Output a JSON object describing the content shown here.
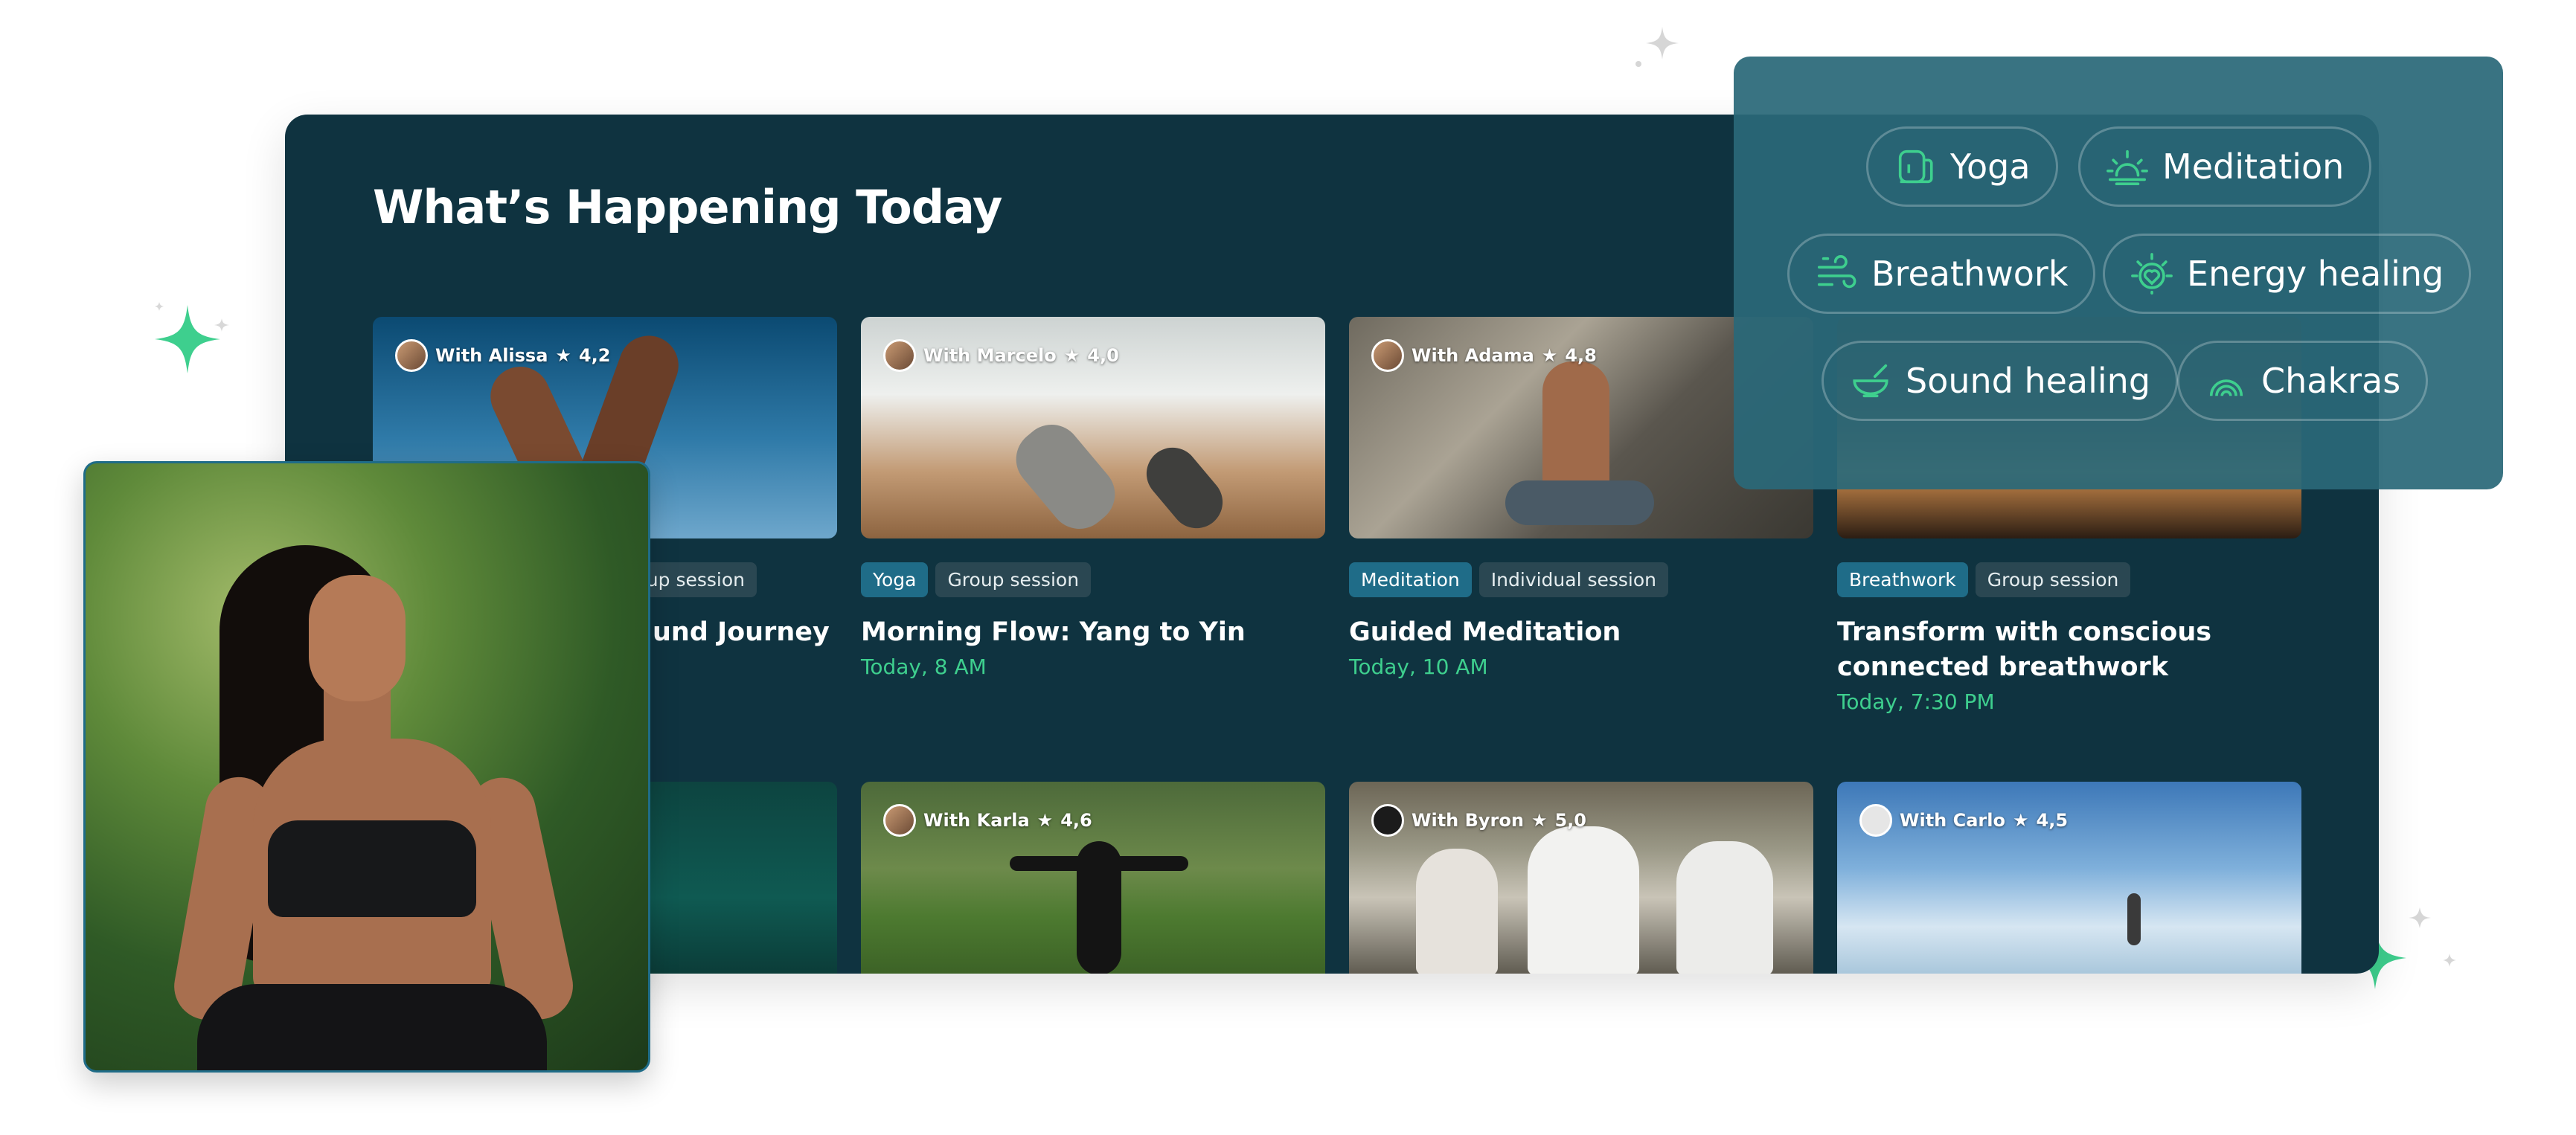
{
  "panel": {
    "title": "What’s Happening Today"
  },
  "row1": [
    {
      "host": "With Alissa",
      "rating": "4,2",
      "tags": [
        "up session"
      ],
      "title": "und Journey",
      "time": ""
    },
    {
      "host": "With Marcelo",
      "rating": "4,0",
      "tags": [
        "Yoga",
        "Group session"
      ],
      "title": "Morning Flow: Yang to Yin",
      "time": "Today, 8 AM"
    },
    {
      "host": "With Adama",
      "rating": "4,8",
      "tags": [
        "Meditation",
        "Individual session"
      ],
      "title": "Guided Meditation",
      "time": "Today, 10 AM"
    },
    {
      "host": "",
      "rating": "",
      "tags": [
        "Breathwork",
        "Group session"
      ],
      "title": "Transform with conscious connected breathwork",
      "time": "Today, 7:30 PM"
    }
  ],
  "row2": [
    {
      "host": "",
      "rating": ""
    },
    {
      "host": "With Karla",
      "rating": "4,6"
    },
    {
      "host": "With Byron",
      "rating": "5,0"
    },
    {
      "host": "With Carlo",
      "rating": "4,5"
    }
  ],
  "categories": [
    {
      "label": "Yoga",
      "icon": "yoga-mat-icon"
    },
    {
      "label": "Meditation",
      "icon": "sunrise-icon"
    },
    {
      "label": "Breathwork",
      "icon": "wind-icon"
    },
    {
      "label": "Energy healing",
      "icon": "heart-sun-icon"
    },
    {
      "label": "Sound healing",
      "icon": "singing-bowl-icon"
    },
    {
      "label": "Chakras",
      "icon": "chakra-icon"
    }
  ],
  "colors": {
    "panel": "#0f3340",
    "accent": "#3ecf8e",
    "tag_category": "#1f6c88",
    "tag_default": "#2a4752",
    "chips_panel": "#2a6878"
  }
}
